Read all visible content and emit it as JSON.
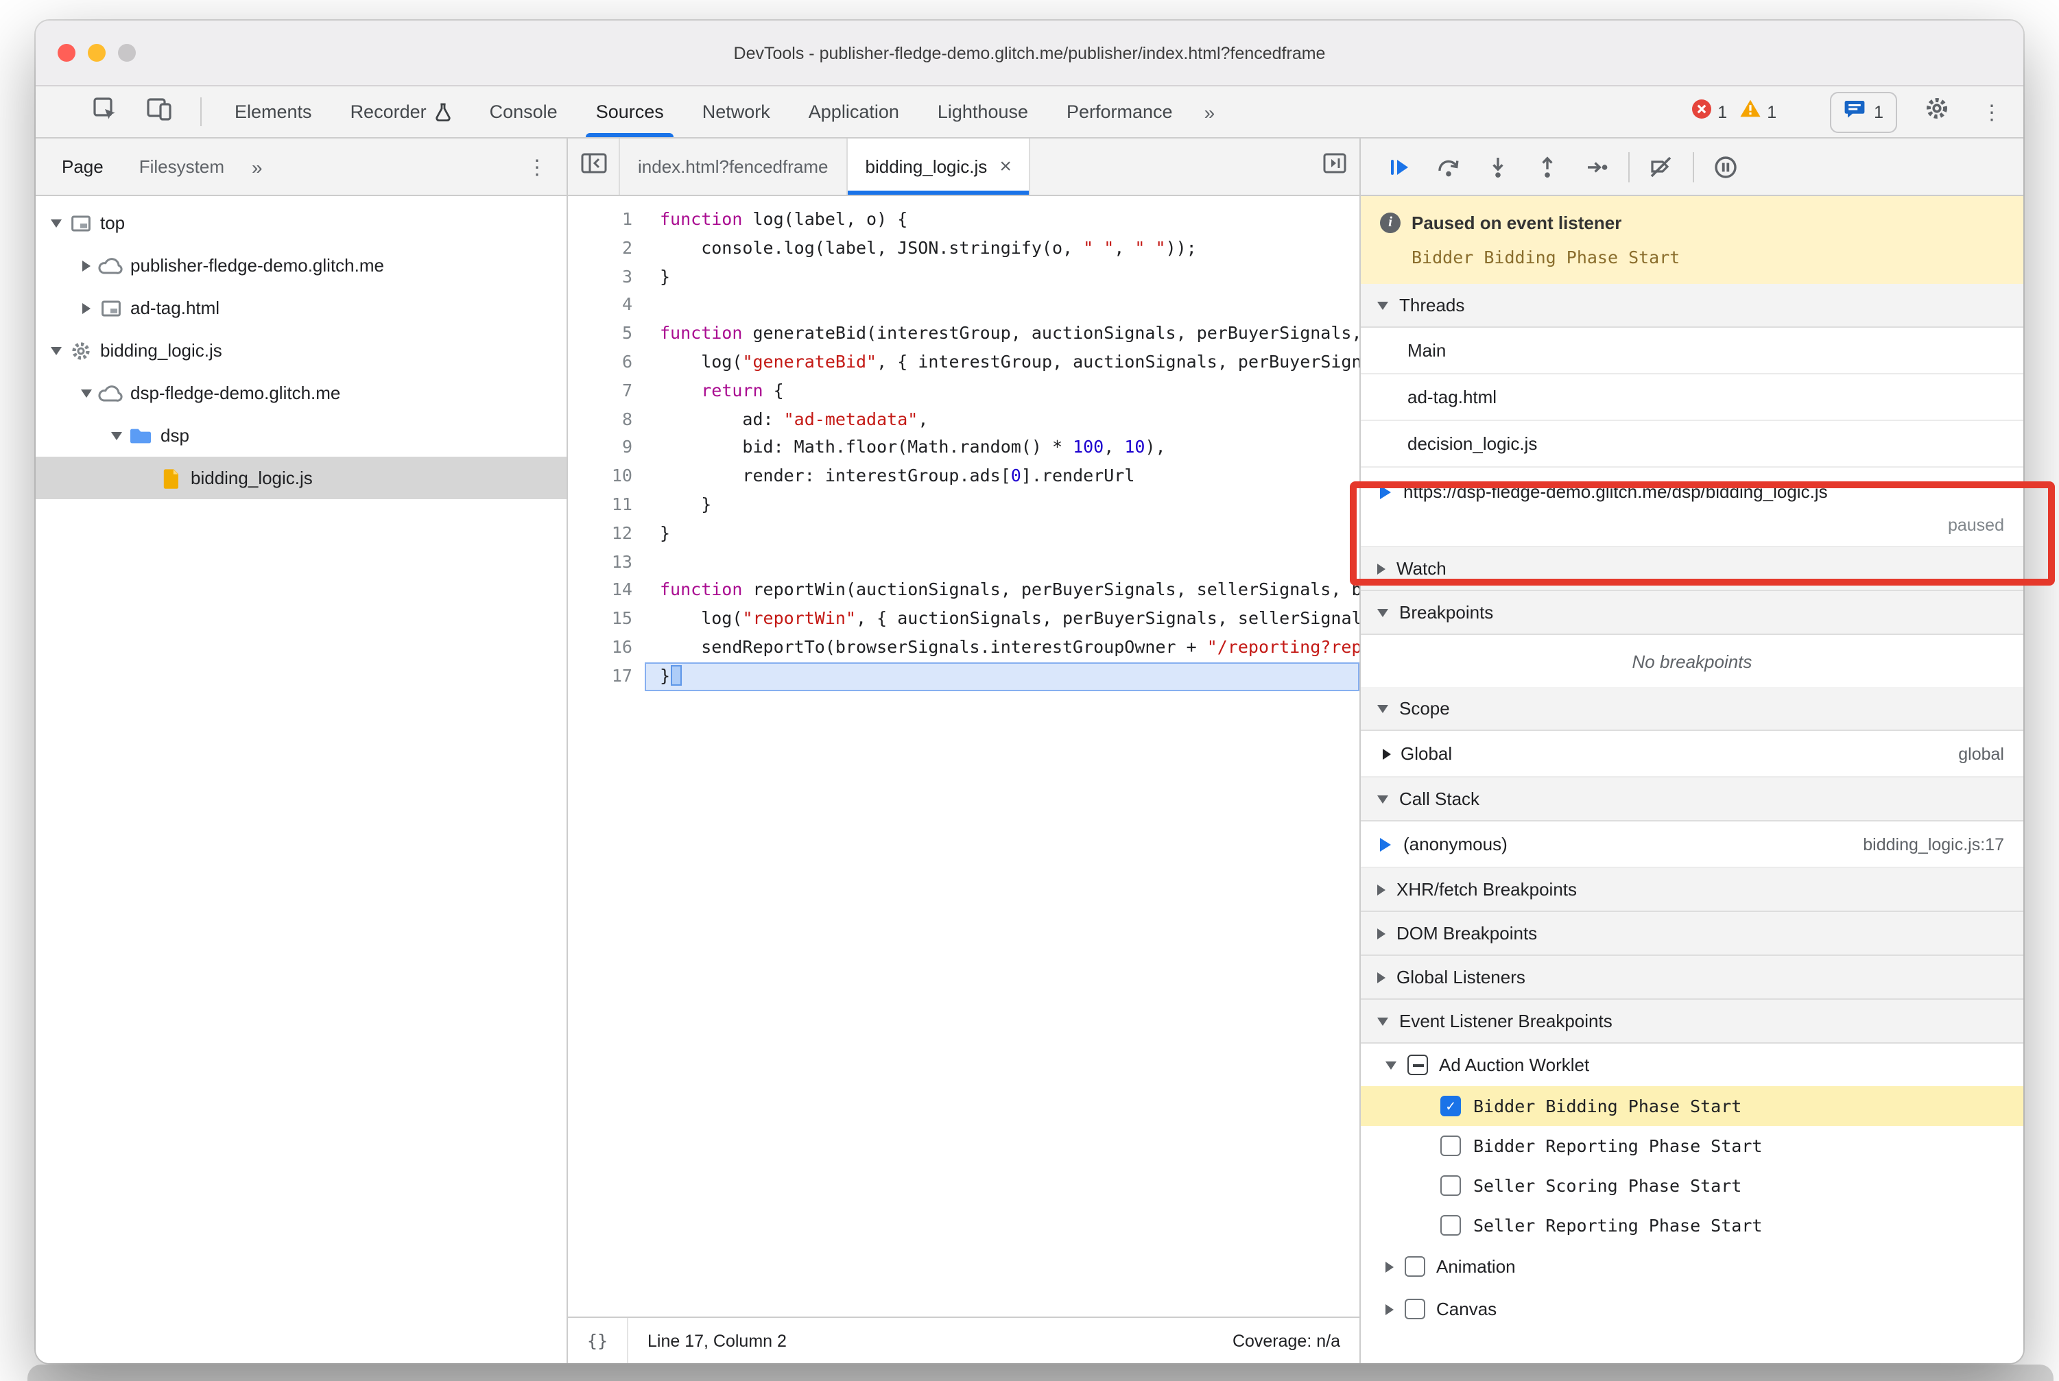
{
  "titlebar": {
    "title": "DevTools - publisher-fledge-demo.glitch.me/publisher/index.html?fencedframe"
  },
  "main_toolbar": {
    "tabs": [
      {
        "label": "Elements"
      },
      {
        "label": "Recorder",
        "badge": "experiment-icon"
      },
      {
        "label": "Console"
      },
      {
        "label": "Sources",
        "active": true
      },
      {
        "label": "Network"
      },
      {
        "label": "Application"
      },
      {
        "label": "Lighthouse"
      },
      {
        "label": "Performance"
      }
    ],
    "overflow": "»",
    "errors": "1",
    "warnings": "1",
    "issues": "1"
  },
  "navigator": {
    "tabs": [
      {
        "label": "Page",
        "active": true
      },
      {
        "label": "Filesystem"
      }
    ],
    "overflow": "»",
    "tree": [
      {
        "label": "top",
        "icon": "frame-icon",
        "level": 0,
        "disclosure": "expanded"
      },
      {
        "label": "publisher-fledge-demo.glitch.me",
        "icon": "cloud-icon",
        "level": 1,
        "disclosure": "collapsed"
      },
      {
        "label": "ad-tag.html",
        "icon": "frame-icon",
        "level": 1,
        "disclosure": "collapsed"
      },
      {
        "label": "bidding_logic.js",
        "icon": "gear-icon",
        "level": 0,
        "disclosure": "expanded"
      },
      {
        "label": "dsp-fledge-demo.glitch.me",
        "icon": "cloud-icon",
        "level": 1,
        "disclosure": "expanded"
      },
      {
        "label": "dsp",
        "icon": "folder-icon",
        "level": 2,
        "disclosure": "expanded"
      },
      {
        "label": "bidding_logic.js",
        "icon": "js-file-icon",
        "level": 3,
        "disclosure": "none",
        "selected": true
      }
    ]
  },
  "editor": {
    "tabs": [
      {
        "label": "index.html?fencedframe"
      },
      {
        "label": "bidding_logic.js",
        "active": true,
        "closable": true
      }
    ],
    "current_line": 17,
    "status": {
      "pretty_print": "{}",
      "position": "Line 17, Column 2",
      "coverage": "Coverage: n/a"
    },
    "lines": [
      [
        [
          "k",
          "function"
        ],
        [
          "p",
          " log(label, o) {"
        ]
      ],
      [
        [
          "p",
          "    console.log(label, JSON.stringify(o, "
        ],
        [
          "s",
          "\" \""
        ],
        [
          "p",
          ", "
        ],
        [
          "s",
          "\" \""
        ],
        [
          "p",
          "));"
        ]
      ],
      [
        [
          "p",
          "}"
        ]
      ],
      [],
      [
        [
          "k",
          "function"
        ],
        [
          "p",
          " generateBid(interestGroup, auctionSignals, perBuyerSignals, trustedBiddingSignals, browserSignals) {"
        ]
      ],
      [
        [
          "p",
          "    log("
        ],
        [
          "s",
          "\"generateBid\""
        ],
        [
          "p",
          ", { interestGroup, auctionSignals, perBuyerSignals, trustedBiddingSignals, browserSignals });"
        ]
      ],
      [
        [
          "p",
          "    "
        ],
        [
          "k",
          "return"
        ],
        [
          "p",
          " {"
        ]
      ],
      [
        [
          "p",
          "        ad: "
        ],
        [
          "s",
          "\"ad-metadata\""
        ],
        [
          "p",
          ","
        ]
      ],
      [
        [
          "p",
          "        bid: Math.floor(Math.random() * "
        ],
        [
          "n",
          "100"
        ],
        [
          "p",
          ", "
        ],
        [
          "n",
          "10"
        ],
        [
          "p",
          "),"
        ]
      ],
      [
        [
          "p",
          "        render: interestGroup.ads["
        ],
        [
          "n",
          "0"
        ],
        [
          "p",
          "].renderUrl"
        ]
      ],
      [
        [
          "p",
          "    }"
        ]
      ],
      [
        [
          "p",
          "}"
        ]
      ],
      [],
      [
        [
          "k",
          "function"
        ],
        [
          "p",
          " reportWin(auctionSignals, perBuyerSignals, sellerSignals, browserSignals) {"
        ]
      ],
      [
        [
          "p",
          "    log("
        ],
        [
          "s",
          "\"reportWin\""
        ],
        [
          "p",
          ", { auctionSignals, perBuyerSignals, sellerSignals, browserSignals });"
        ]
      ],
      [
        [
          "p",
          "    sendReportTo(browserSignals.interestGroupOwner + "
        ],
        [
          "s",
          "\"/reporting?report=win\""
        ],
        [
          "p",
          ");"
        ]
      ],
      [
        [
          "p",
          "}"
        ]
      ]
    ]
  },
  "debugger": {
    "toolbar_icons": [
      "resume-icon",
      "step-over-icon",
      "step-into-icon",
      "step-out-icon",
      "step-icon",
      "deactivate-breakpoints-icon",
      "pause-on-exceptions-icon"
    ],
    "paused": {
      "title": "Paused on event listener",
      "detail": "Bidder Bidding Phase Start"
    },
    "threads": {
      "label": "Threads",
      "items": [
        {
          "label": "Main"
        },
        {
          "label": "ad-tag.html"
        },
        {
          "label": "decision_logic.js"
        },
        {
          "label": "https://dsp-fledge-demo.glitch.me/dsp/bidding_logic.js",
          "current": true,
          "status": "paused"
        }
      ]
    },
    "watch": {
      "label": "Watch"
    },
    "breakpoints": {
      "label": "Breakpoints",
      "empty_text": "No breakpoints"
    },
    "scope": {
      "label": "Scope",
      "items": [
        {
          "label": "Global",
          "hint": "global"
        }
      ]
    },
    "call_stack": {
      "label": "Call Stack",
      "items": [
        {
          "label": "(anonymous)",
          "location": "bidding_logic.js:17",
          "current": true
        }
      ]
    },
    "collapsed_sections": [
      {
        "label": "XHR/fetch Breakpoints"
      },
      {
        "label": "DOM Breakpoints"
      },
      {
        "label": "Global Listeners"
      }
    ],
    "event_listener_breakpoints": {
      "label": "Event Listener Breakpoints",
      "groups": [
        {
          "label": "Ad Auction Worklet",
          "checkbox": "indeterminate",
          "disclosure": "expanded",
          "children": [
            {
              "label": "Bidder Bidding Phase Start",
              "checkbox": "checked",
              "highlighted": true
            },
            {
              "label": "Bidder Reporting Phase Start",
              "checkbox": "unchecked"
            },
            {
              "label": "Seller Scoring Phase Start",
              "checkbox": "unchecked"
            },
            {
              "label": "Seller Reporting Phase Start",
              "checkbox": "unchecked"
            }
          ]
        },
        {
          "label": "Animation",
          "checkbox": "unchecked",
          "disclosure": "collapsed"
        },
        {
          "label": "Canvas",
          "checkbox": "unchecked",
          "disclosure": "collapsed"
        }
      ]
    }
  },
  "annotation": {
    "shape": "red-highlight-box",
    "color": "#e5382b"
  }
}
